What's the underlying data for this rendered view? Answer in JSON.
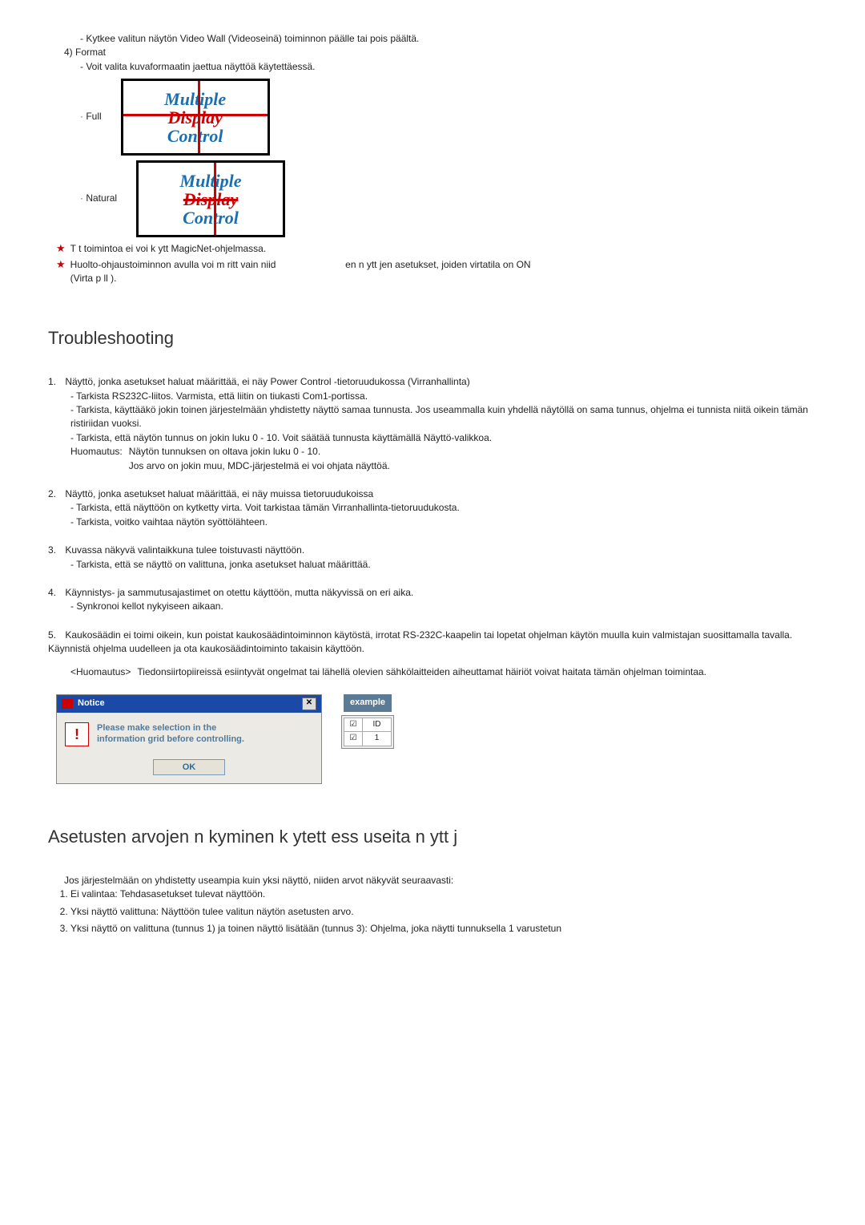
{
  "top": {
    "bullet1": "Kytkee valitun näytön Video Wall (Videoseinä) toiminnon päälle tai pois päältä.",
    "item4_label": "4)  Format",
    "item4_sub": "Voit valita kuvaformaatin jaettua näyttöä käytettäessä.",
    "format_full": "Full",
    "format_natural": "Natural"
  },
  "tile_text": {
    "l1": "Multiple",
    "l2": "Display",
    "l3": "Control"
  },
  "stars": {
    "s1": "T t  toimintoa ei voi k ytt   MagicNet-ohjelmassa.",
    "s2a": "Huolto-ohjaustoiminnon avulla voi m  ritt   vain niid",
    "s2b": "en n ytt jen asetukset, joiden virtatila on ON",
    "s2c": "(Virta p  ll )."
  },
  "troubleshooting_title": "Troubleshooting",
  "tb": [
    {
      "n": "1.",
      "head": "Näyttö, jonka asetukset haluat määrittää, ei näy Power Control -tietoruudukossa (Virranhallinta)",
      "subs": [
        "Tarkista RS232C-liitos. Varmista, että liitin on tiukasti Com1-portissa.",
        "Tarkista, käyttääkö jokin toinen järjestelmään yhdistetty näyttö samaa tunnusta. Jos useammalla kuin yhdellä näytöllä on sama tunnus, ohjelma ei tunnista niitä oikein tämän ristiriidan vuoksi.",
        "Tarkista, että näytön tunnus on jokin luku 0 - 10. Voit säätää tunnusta käyttämällä Näyttö-valikkoa."
      ],
      "note_label": "Huomautus:",
      "note_lines": [
        "Näytön tunnuksen on oltava jokin luku 0 - 10.",
        "Jos arvo on jokin muu, MDC-järjestelmä ei voi ohjata näyttöä."
      ]
    },
    {
      "n": "2.",
      "head": "Näyttö, jonka asetukset haluat määrittää, ei näy muissa tietoruudukoissa",
      "subs": [
        "Tarkista, että näyttöön on kytketty virta. Voit tarkistaa tämän Virranhallinta-tietoruudukosta.",
        "Tarkista, voitko vaihtaa näytön syöttölähteen."
      ]
    },
    {
      "n": "3.",
      "head": "Kuvassa näkyvä valintaikkuna tulee toistuvasti näyttöön.",
      "subs": [
        "Tarkista, että se näyttö on valittuna, jonka asetukset haluat määrittää."
      ]
    },
    {
      "n": "4.",
      "head": "Käynnistys- ja sammutusajastimet on otettu käyttöön, mutta näkyvissä on eri aika.",
      "subs": [
        "Synkronoi kellot nykyiseen aikaan."
      ]
    },
    {
      "n": "5.",
      "head": "Kaukosäädin ei toimi oikein, kun poistat kaukosäädintoiminnon käytöstä, irrotat RS-232C-kaapelin tai lopetat ohjelman käytön muulla kuin valmistajan suosittamalla tavalla. Käynnistä ohjelma uudelleen ja ota kaukosäädintoiminto takaisin käyttöön.",
      "huom_label": "<Huomautus>",
      "huom_text": "Tiedonsiirtopiireissä esiintyvät ongelmat tai lähellä olevien sähkölaitteiden aiheuttamat häiriöt voivat haitata tämän ohjelman toimintaa."
    }
  ],
  "notice": {
    "title": "Notice",
    "msg1": "Please make selection in the",
    "msg2": "information grid before controlling.",
    "ok": "OK",
    "close": "✕",
    "example": "example",
    "grid_h1": "☑",
    "grid_h2": "ID",
    "grid_v1": "☑",
    "grid_v2": "1"
  },
  "section3_title": "Asetusten arvojen n kyminen k ytett ess  useita n ytt j",
  "section3_intro": "Jos järjestelmään on yhdistetty useampia kuin yksi näyttö, niiden arvot näkyvät seuraavasti:",
  "s3_items": [
    "Ei valintaa: Tehdasasetukset tulevat näyttöön.",
    "Yksi näyttö valittuna: Näyttöön tulee valitun näytön asetusten arvo.",
    "Yksi näyttö on valittuna (tunnus 1) ja toinen näyttö lisätään (tunnus 3): Ohjelma, joka näytti tunnuksella 1 varustetun"
  ]
}
